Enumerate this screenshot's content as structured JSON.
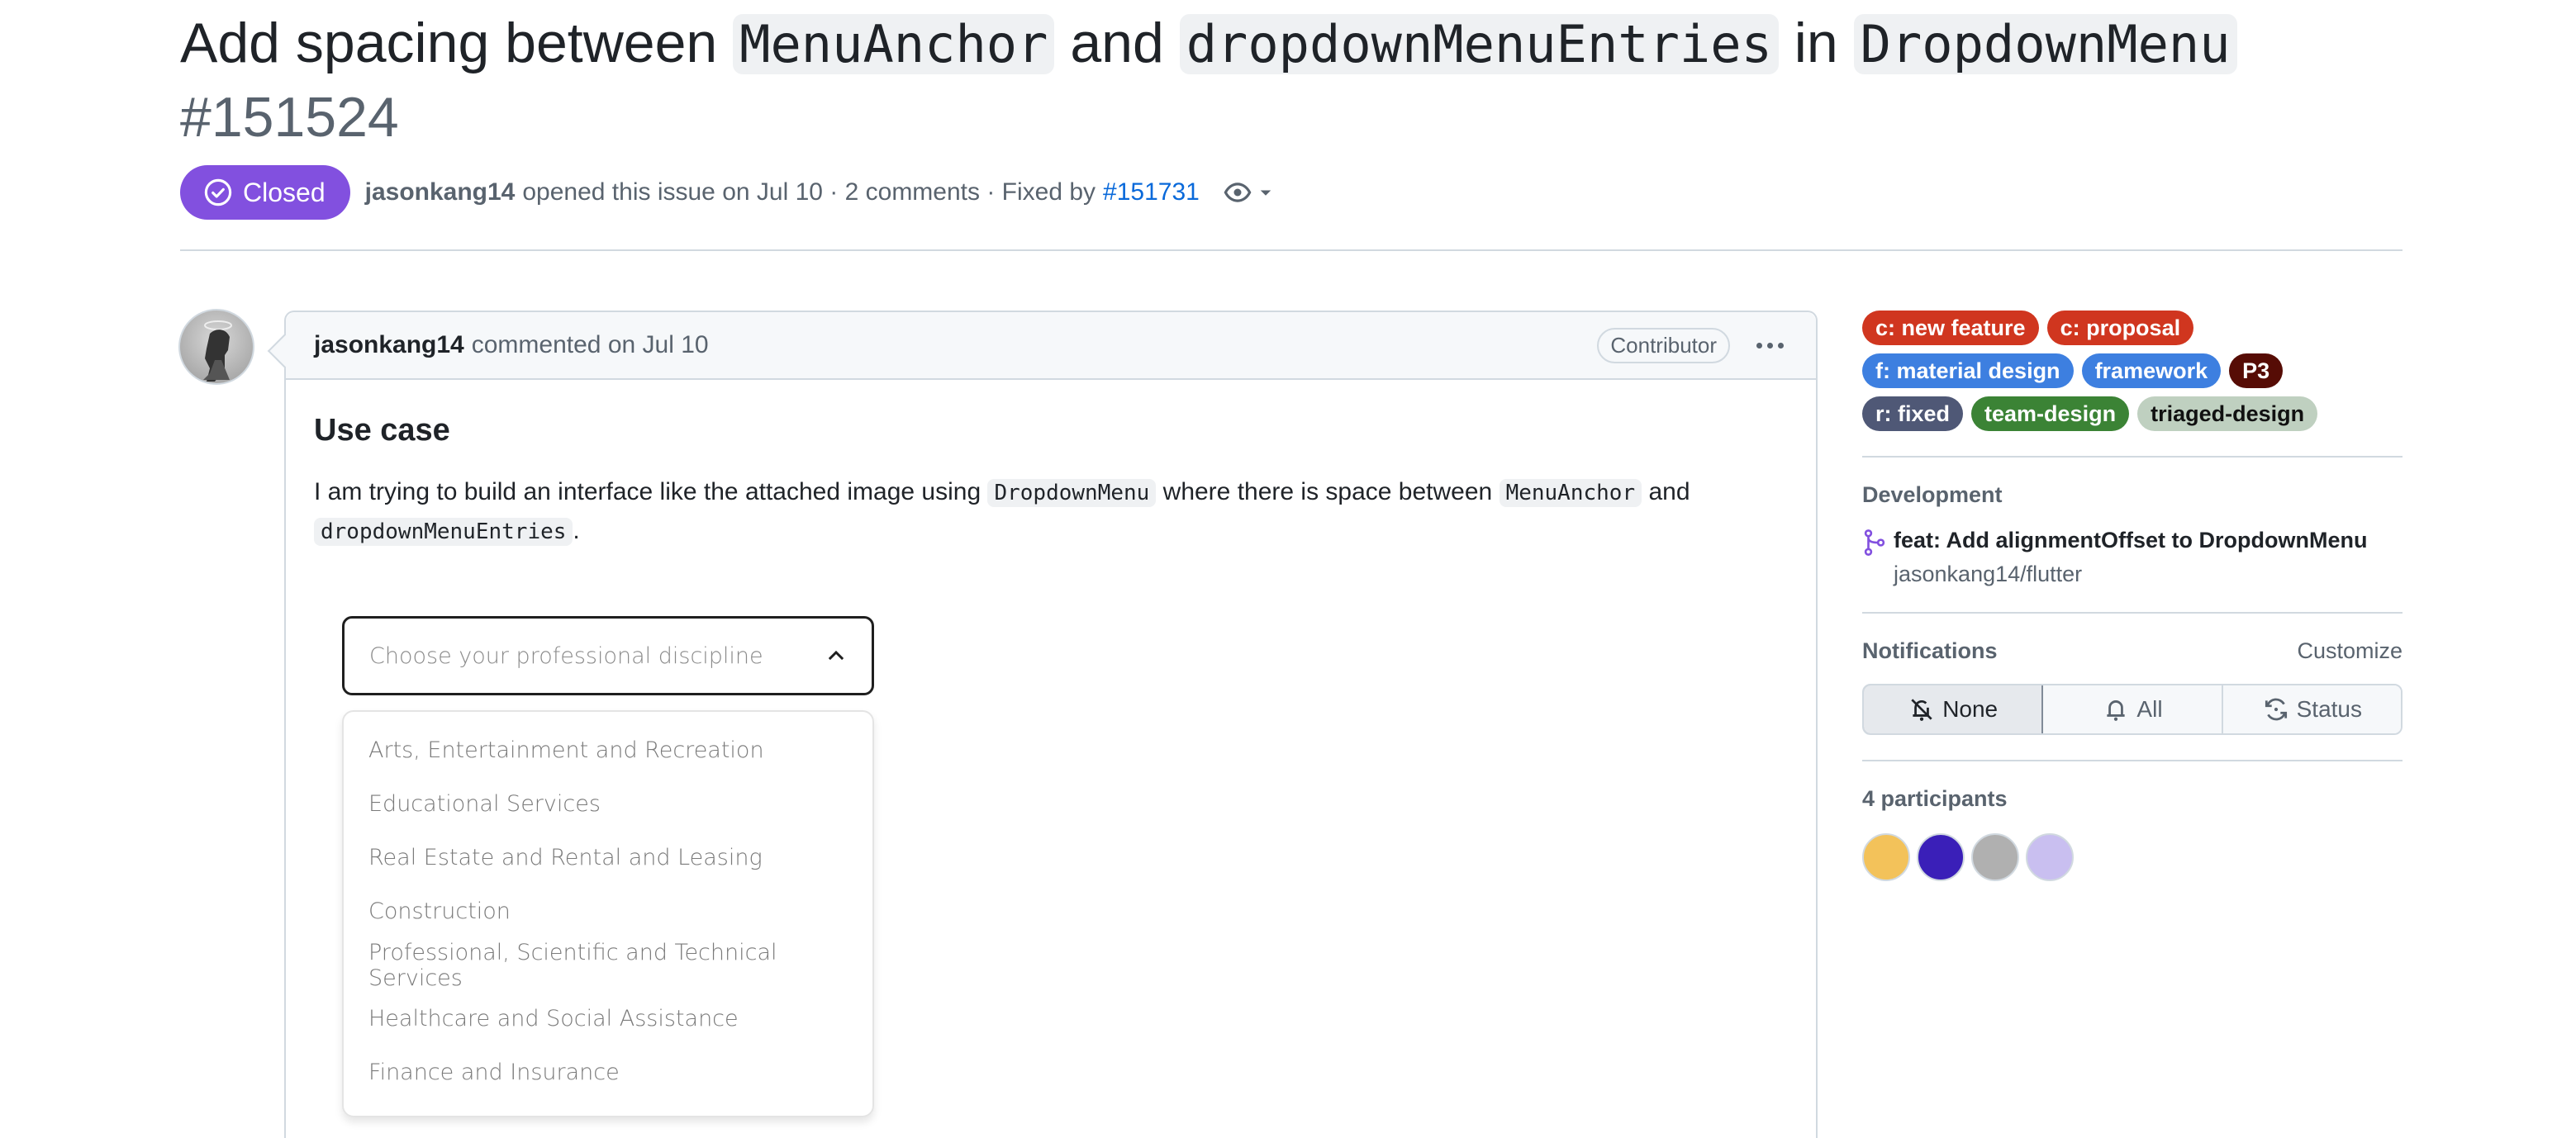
{
  "issue": {
    "title_parts": [
      {
        "text": "Add spacing between ",
        "code": false
      },
      {
        "text": "MenuAnchor",
        "code": true
      },
      {
        "text": " and ",
        "code": false
      },
      {
        "text": "dropdownMenuEntries",
        "code": true
      },
      {
        "text": " in ",
        "code": false
      },
      {
        "text": "DropdownMenu",
        "code": true
      }
    ],
    "number": "#151524",
    "state": "Closed",
    "state_color": "#8250df",
    "author": "jasonkang14",
    "opened_text": "opened this issue on Jul 10 · 2 comments · Fixed by",
    "fixed_by": "#151731"
  },
  "comment": {
    "author": "jasonkang14",
    "action": "commented on Jul 10",
    "role": "Contributor",
    "heading": "Use case",
    "paragraph": [
      {
        "text": "I am trying to build an interface like the attached image using ",
        "code": false
      },
      {
        "text": "DropdownMenu",
        "code": true
      },
      {
        "text": " where there is space between ",
        "code": false
      },
      {
        "text": "MenuAnchor",
        "code": true
      },
      {
        "text": " and ",
        "code": false
      },
      {
        "text": "dropdownMenuEntries",
        "code": true
      },
      {
        "text": ".",
        "code": false
      }
    ],
    "embed": {
      "placeholder": "Choose your professional discipline",
      "items": [
        "Arts, Entertainment and Recreation",
        "Educational Services",
        "Real Estate and Rental and Leasing",
        "Construction",
        "Professional, Scientific and Technical Services",
        "Healthcare and Social Assistance",
        "Finance and Insurance"
      ]
    }
  },
  "sidebar": {
    "labels": [
      {
        "text": "c: new feature",
        "bg": "#d0361f",
        "fg": "#ffffff"
      },
      {
        "text": "c: proposal",
        "bg": "#d0361f",
        "fg": "#ffffff"
      },
      {
        "text": "f: material design",
        "bg": "#3d7fe0",
        "fg": "#ffffff"
      },
      {
        "text": "framework",
        "bg": "#3d7fe0",
        "fg": "#ffffff"
      },
      {
        "text": "P3",
        "bg": "#560c05",
        "fg": "#ffffff"
      },
      {
        "text": "r: fixed",
        "bg": "#4f5876",
        "fg": "#ffffff"
      },
      {
        "text": "team-design",
        "bg": "#3b8335",
        "fg": "#ffffff"
      },
      {
        "text": "triaged-design",
        "bg": "#bfd0c0",
        "fg": "#111111"
      }
    ],
    "development": {
      "title": "Development",
      "pr_title": "feat: Add alignmentOffset to DropdownMenu",
      "repo": "jasonkang14/flutter"
    },
    "notifications": {
      "title": "Notifications",
      "customize": "Customize",
      "options": [
        {
          "label": "None",
          "icon": "bell-slash-icon",
          "selected": true
        },
        {
          "label": "All",
          "icon": "bell-icon",
          "selected": false
        },
        {
          "label": "Status",
          "icon": "sync-icon",
          "selected": false
        }
      ]
    },
    "participants": {
      "title": "4 participants",
      "avatars": [
        {
          "name": "participant-1",
          "bg": "#f3c25a"
        },
        {
          "name": "participant-2",
          "bg": "#3a1fb8"
        },
        {
          "name": "participant-3",
          "bg": "#b0b0b0"
        },
        {
          "name": "participant-4",
          "bg": "#c9bff0"
        }
      ]
    }
  }
}
